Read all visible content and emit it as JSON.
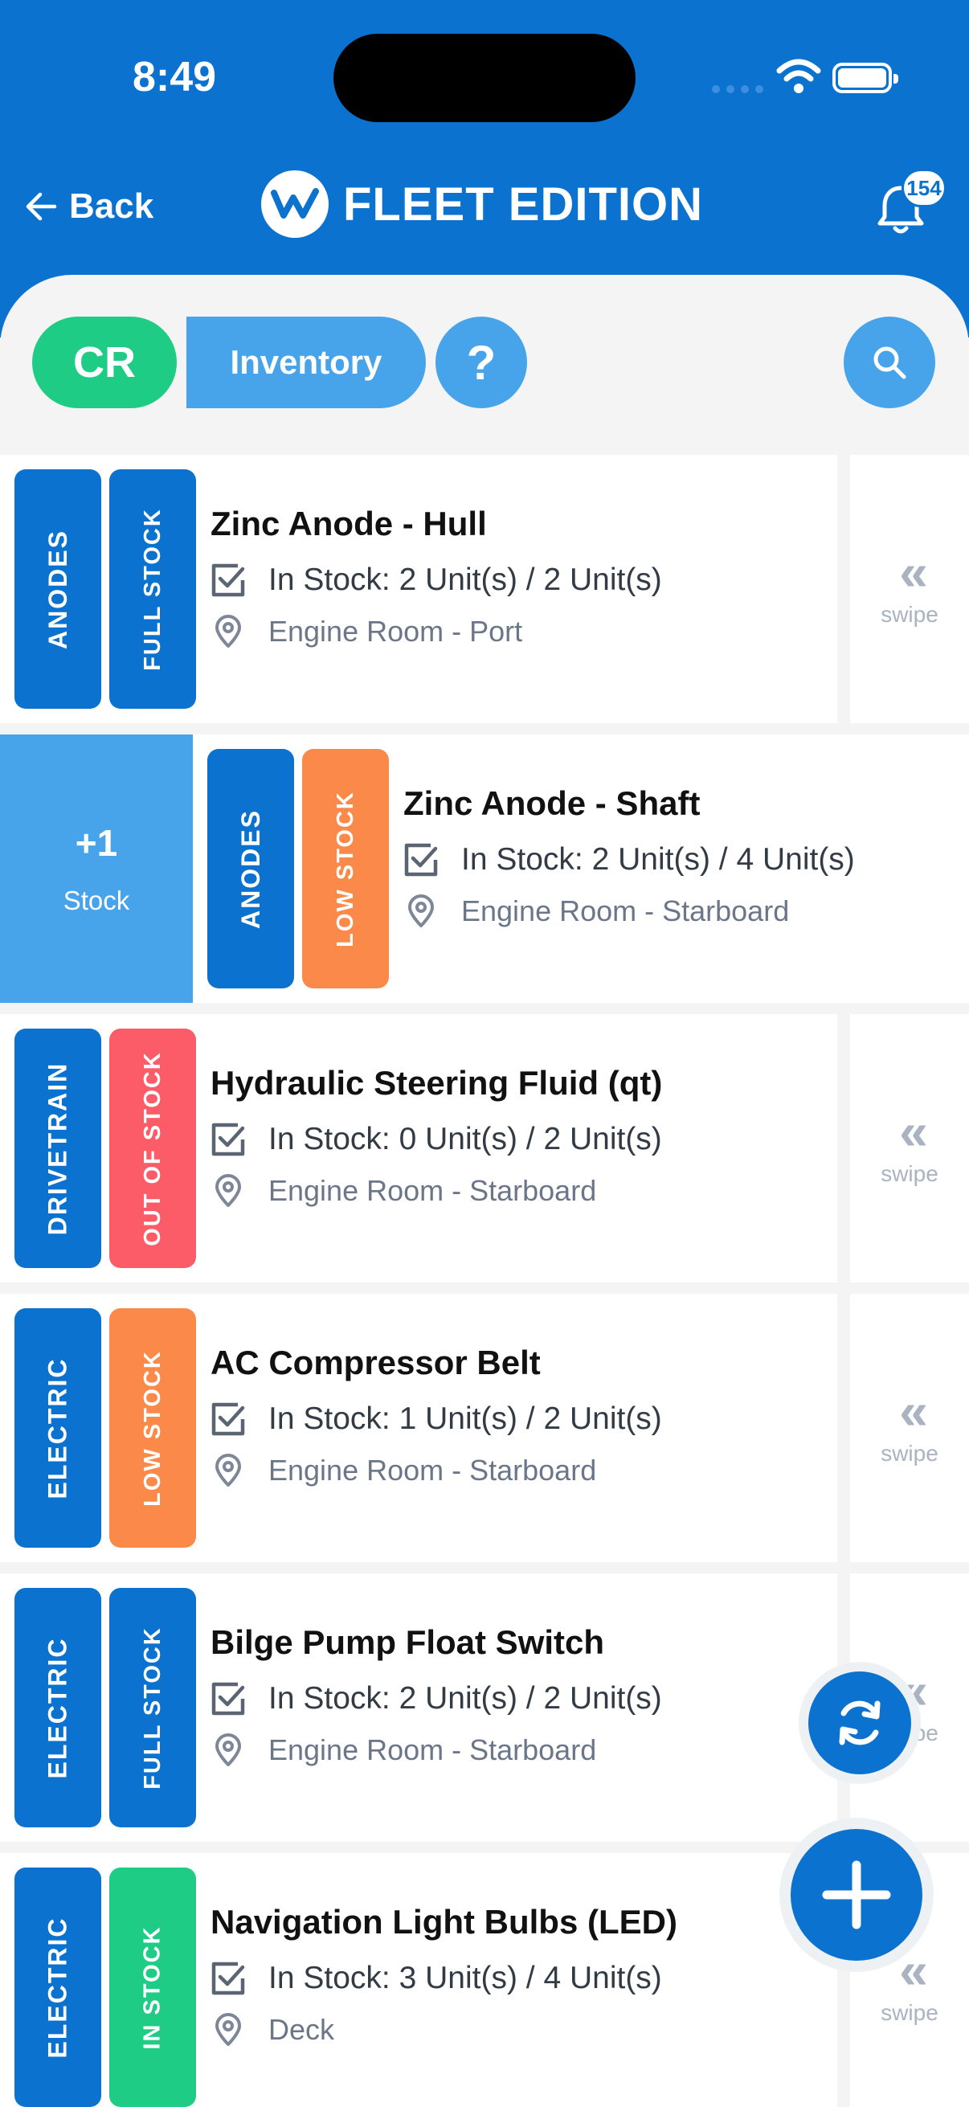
{
  "status_bar": {
    "time": "8:49"
  },
  "header": {
    "back_label": "Back",
    "brand_title": "FLEET EDITION",
    "notification_count": "154"
  },
  "toolbar": {
    "crew_badge": "CR",
    "section_label": "Inventory",
    "help_label": "?"
  },
  "swipe_hint": "swipe",
  "swipe_chevron": "«",
  "in_stock_prefix": "In Stock:",
  "revealed_action": {
    "value": "+1",
    "label": "Stock"
  },
  "items": [
    {
      "name": "Zinc Anode - Hull",
      "category": "ANODES",
      "stock_status": "FULL STOCK",
      "stock": "2 Unit(s) / 2 Unit(s)",
      "location": "Engine Room - Port",
      "status_color": "#0b73cf"
    },
    {
      "name": "Zinc Anode - Shaft",
      "category": "ANODES",
      "stock_status": "LOW STOCK",
      "stock": "2 Unit(s) / 4 Unit(s)",
      "location": "Engine Room - Starboard",
      "status_color": "#fb8a4a"
    },
    {
      "name": "Hydraulic Steering Fluid (qt)",
      "category": "DRIVETRAIN",
      "stock_status": "OUT OF STOCK",
      "stock": "0 Unit(s) / 2 Unit(s)",
      "location": "Engine Room - Starboard",
      "status_color": "#fb5c67"
    },
    {
      "name": "AC Compressor Belt",
      "category": "ELECTRIC",
      "stock_status": "LOW STOCK",
      "stock": "1 Unit(s) / 2 Unit(s)",
      "location": "Engine Room - Starboard",
      "status_color": "#fb8a4a"
    },
    {
      "name": "Bilge Pump Float Switch",
      "category": "ELECTRIC",
      "stock_status": "FULL STOCK",
      "stock": "2 Unit(s) / 2 Unit(s)",
      "location": "Engine Room - Starboard",
      "status_color": "#0b73cf"
    },
    {
      "name": "Navigation Light Bulbs (LED)",
      "category": "ELECTRIC",
      "stock_status": "IN STOCK",
      "stock": "3 Unit(s) / 4 Unit(s)",
      "location": "Deck",
      "status_color": "#1fcc86"
    }
  ],
  "colors": {
    "primary": "#0b73cf",
    "accent": "#47a3ea",
    "green": "#1fcc86"
  }
}
